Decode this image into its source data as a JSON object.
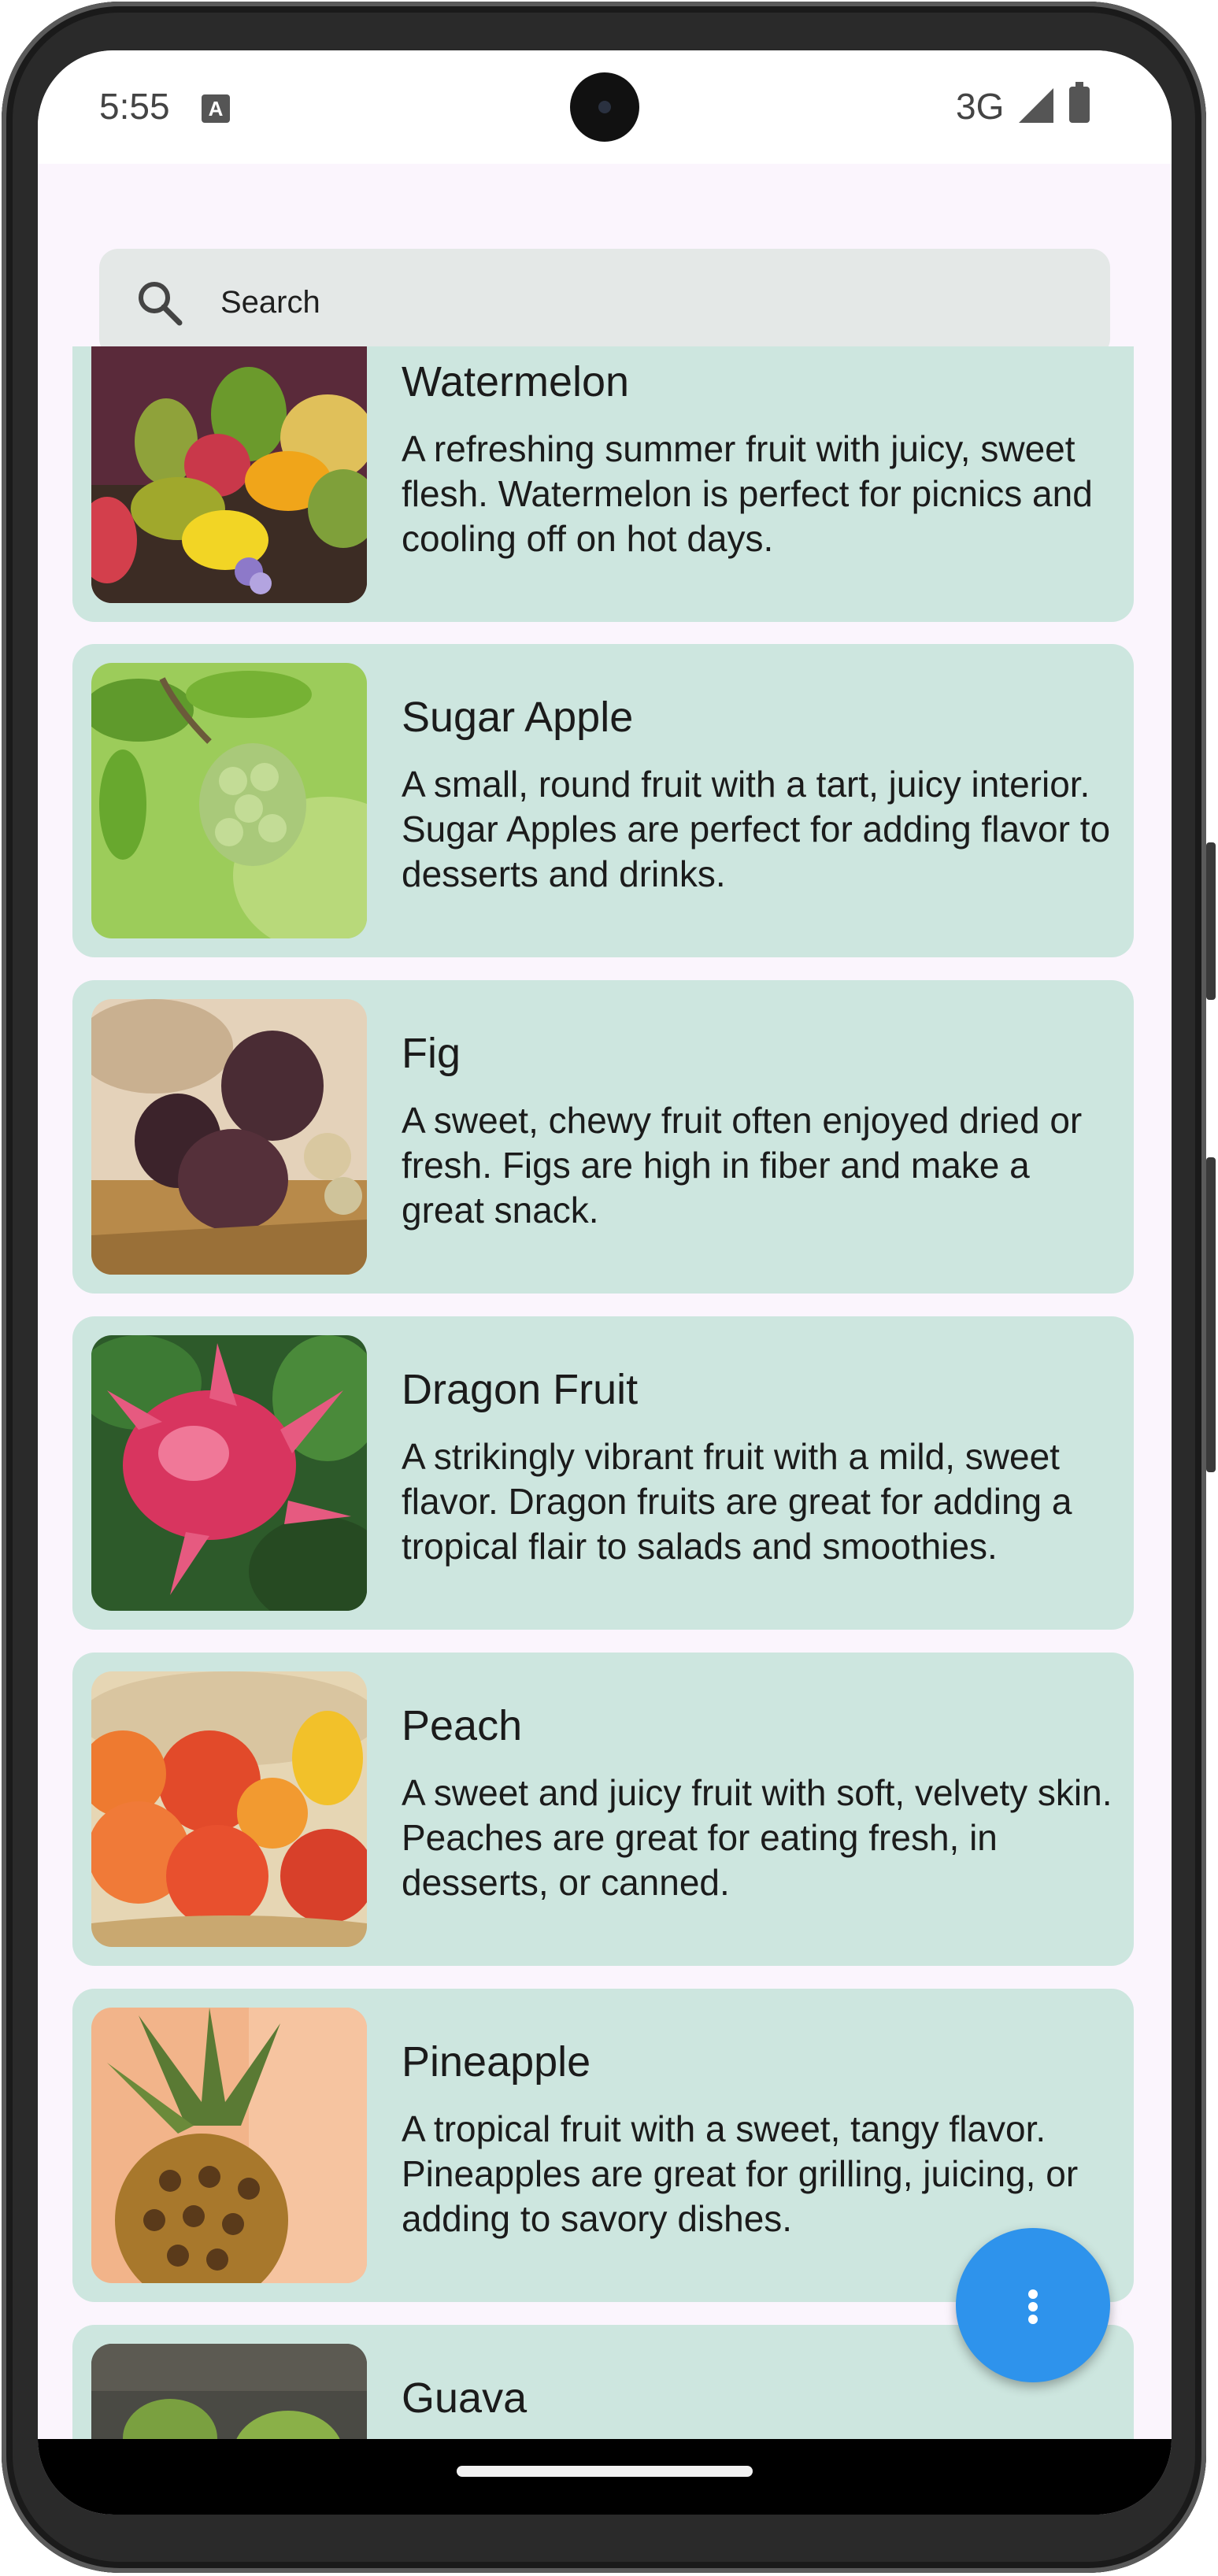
{
  "status_bar": {
    "time": "5:55",
    "network": "3G",
    "icons": [
      "keyboard-a-icon",
      "signal-icon",
      "battery-icon"
    ]
  },
  "search": {
    "placeholder": "Search",
    "icon": "search-icon"
  },
  "fruits": [
    {
      "name": "Watermelon",
      "description": "A refreshing summer fruit with juicy, sweet flesh. Watermelon is perfect for picnics and cooling off on hot days."
    },
    {
      "name": "Sugar Apple",
      "description": "A small, round fruit with a tart, juicy interior. Sugar Apples are perfect for adding flavor to desserts and drinks."
    },
    {
      "name": "Fig",
      "description": "A sweet, chewy fruit often enjoyed dried or fresh. Figs are high in fiber and make a great snack."
    },
    {
      "name": "Dragon Fruit",
      "description": "A strikingly vibrant fruit with a mild, sweet flavor. Dragon fruits are great for adding a tropical flair to salads and smoothies."
    },
    {
      "name": "Peach",
      "description": "A sweet and juicy fruit with soft, velvety skin. Peaches are great for eating fresh, in desserts, or canned."
    },
    {
      "name": "Pineapple",
      "description": "A tropical fruit with a sweet, tangy flavor. Pineapples are great for grilling, juicing, or adding to savory dishes."
    },
    {
      "name": "Guava",
      "description": ""
    }
  ],
  "fab": {
    "icon": "more-vert-icon"
  },
  "colors": {
    "card": "#cde6df",
    "fab": "#2e93ec",
    "background": "#fbf5fd",
    "search": "#e4e8e7"
  }
}
